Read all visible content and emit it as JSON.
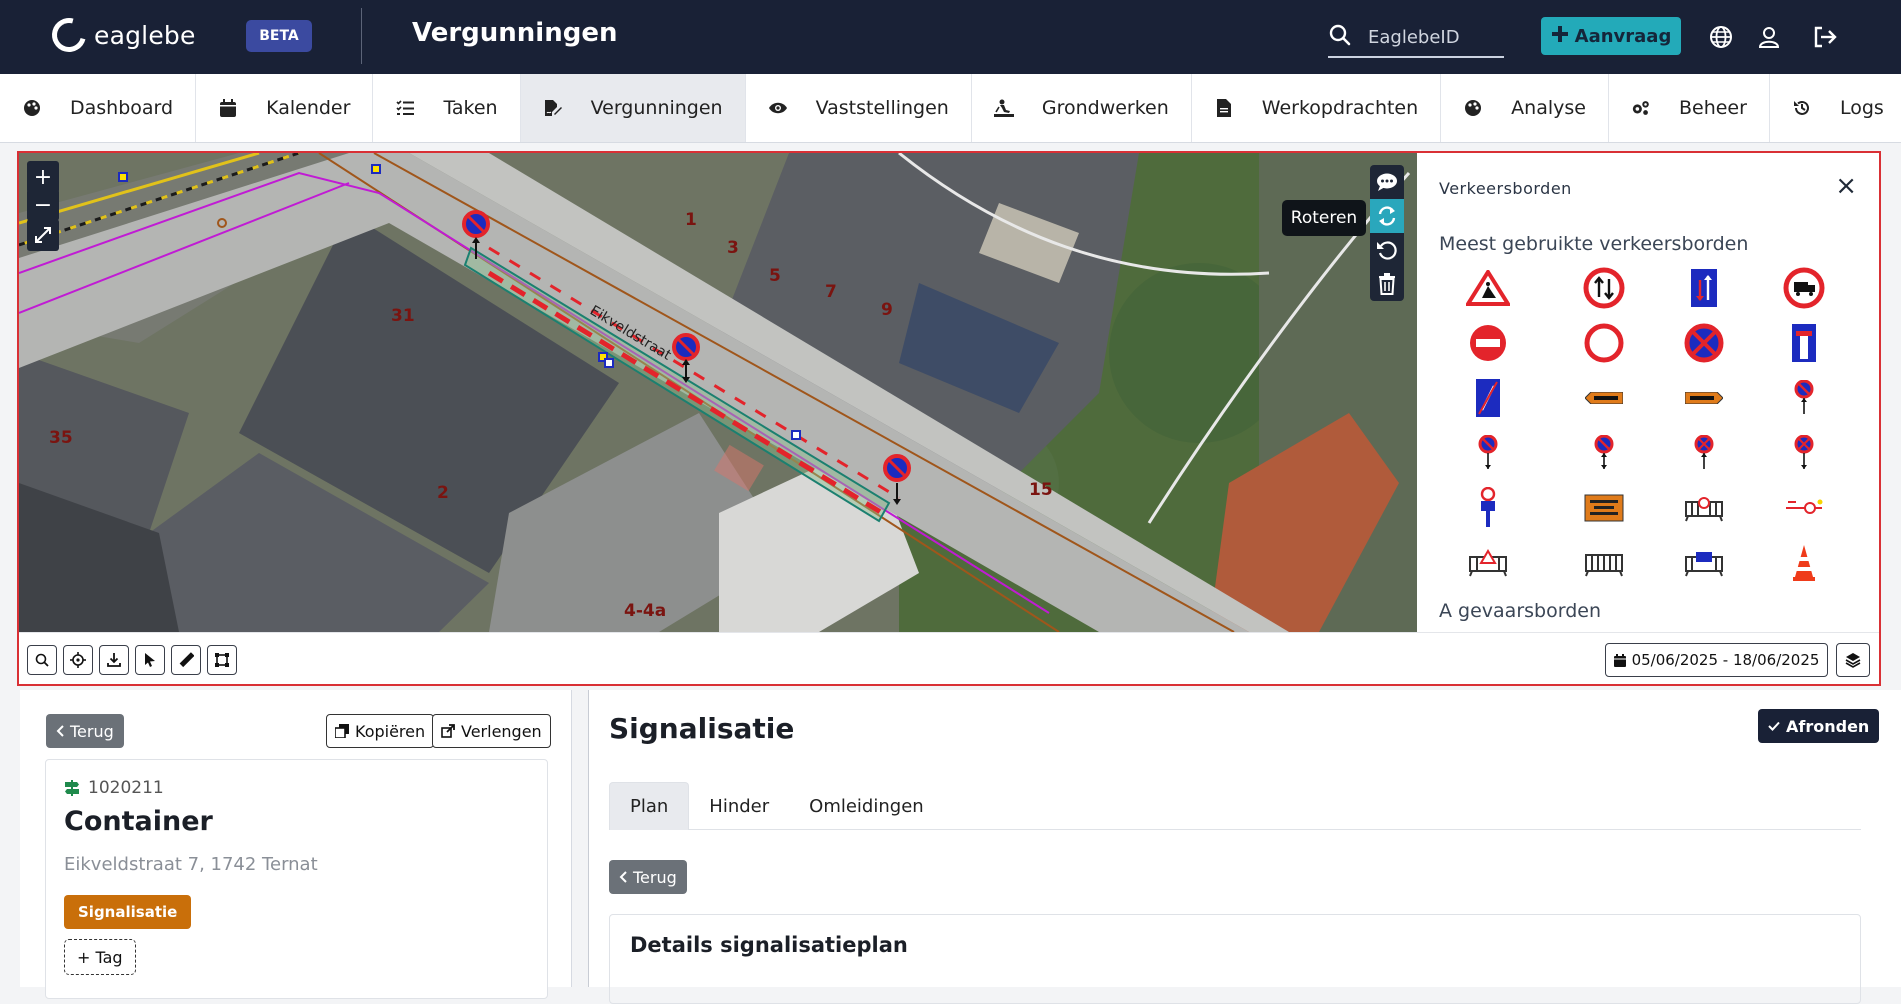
{
  "header": {
    "logo_text": "eaglebe",
    "beta_label": "BETA",
    "app_title": "Vergunningen",
    "search_placeholder": "EaglebeID",
    "aanvraag_label": "Aanvraag"
  },
  "nav": {
    "items": [
      {
        "label": "Dashboard",
        "icon": "palette-icon"
      },
      {
        "label": "Kalender",
        "icon": "calendar-icon"
      },
      {
        "label": "Taken",
        "icon": "checklist-icon"
      },
      {
        "label": "Vergunningen",
        "icon": "file-signature-icon",
        "active": true
      },
      {
        "label": "Vaststellingen",
        "icon": "eye-icon"
      },
      {
        "label": "Grondwerken",
        "icon": "digging-icon"
      },
      {
        "label": "Werkopdrachten",
        "icon": "file-icon"
      },
      {
        "label": "Analyse",
        "icon": "palette-icon"
      },
      {
        "label": "Beheer",
        "icon": "cogs-icon"
      },
      {
        "label": "Logs",
        "icon": "history-icon"
      }
    ]
  },
  "map": {
    "tooltip": "Roteren",
    "street_name": "Eikveldstraat",
    "house_numbers": [
      "1",
      "3",
      "5",
      "7",
      "9",
      "31",
      "35",
      "2",
      "15",
      "4-4a"
    ],
    "date_range": "05/06/2025 - 18/06/2025",
    "colors": {
      "accent": "#2aa7bc",
      "frame": "#d93035",
      "dark": "#1e2636"
    }
  },
  "sign_panel": {
    "title": "Verkeersborden",
    "close": "×",
    "subtitle": "Meest gebruikte verkeersborden",
    "next_section": "A gevaarsborden",
    "sign_count": 24
  },
  "left": {
    "back_label": "Terug",
    "copy_label": "Kopiëren",
    "extend_label": "Verlengen",
    "card": {
      "id": "1020211",
      "title": "Container",
      "address": "Eikveldstraat 7, 1742 Ternat",
      "tag": "Signalisatie",
      "add_tag": "+ Tag"
    }
  },
  "right": {
    "title": "Signalisatie",
    "finish_label": "Afronden",
    "tabs": [
      "Plan",
      "Hinder",
      "Omleidingen"
    ],
    "back_label": "Terug",
    "details_title": "Details signalisatieplan"
  }
}
